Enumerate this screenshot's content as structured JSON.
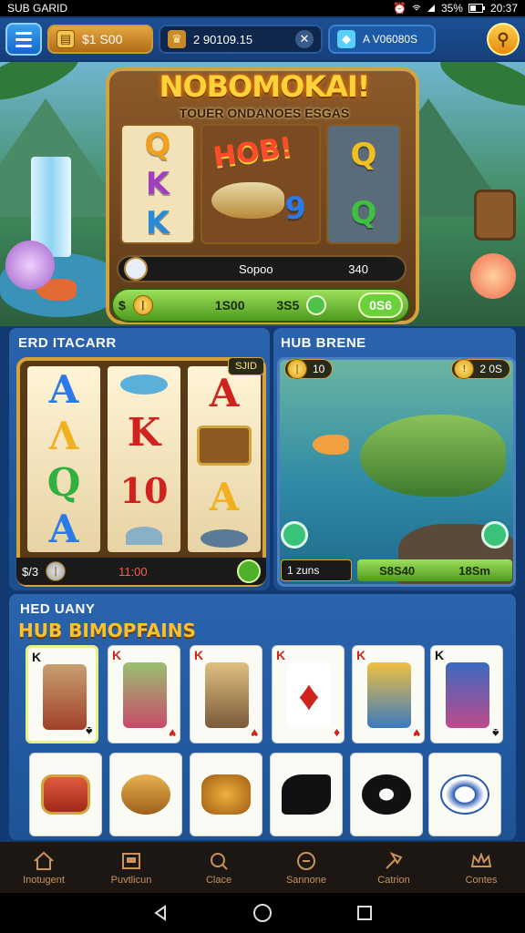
{
  "status_bar": {
    "left": "SUB GARID",
    "battery_text": "35%",
    "time": "20:37"
  },
  "topbar": {
    "coins": "$1 S00",
    "balance": "2 90109.15",
    "gems": "A V06080S"
  },
  "hero": {
    "title": "NOBOMOKAI!",
    "subtitle": "TOUER ONDANOES ESGAS",
    "big_label": "HOB!",
    "reel1": [
      "Q",
      "K",
      "K"
    ],
    "reel3": [
      "Q",
      "Q"
    ],
    "reel2_symbol": "9",
    "bar1_label": "Sopoo",
    "bar1_value": "340",
    "bar2_coin": "$",
    "bar2_value1": "1S00",
    "bar2_value2": "3S5",
    "bar2_last": "0S6"
  },
  "panel_left": {
    "title": "ERD ITACARR",
    "badge": "SJID",
    "reel1": [
      "A",
      "Λ",
      "Q",
      "A"
    ],
    "reel2": [
      "K",
      "10"
    ],
    "reel3": [
      "A",
      "A"
    ],
    "foot_left": "$/3",
    "foot_mid": "11:00"
  },
  "panel_right": {
    "title": "HUB BRENE",
    "chip_left": "10",
    "chip_right": "2 0S",
    "foot_label": "1 zuns",
    "foot_value1": "S8S40",
    "foot_value2": "18Sm"
  },
  "cards": {
    "header": "HED UANY",
    "subheader": "HUB BIMOPFAINS",
    "row1": [
      {
        "rank": "K",
        "suit": "♠",
        "color": "blk"
      },
      {
        "rank": "K",
        "suit": "♥",
        "color": "red"
      },
      {
        "rank": "K",
        "suit": "♥",
        "color": "red"
      },
      {
        "rank": "K",
        "suit": "♦",
        "color": "red"
      },
      {
        "rank": "K",
        "suit": "♥",
        "color": "red"
      },
      {
        "rank": "K",
        "suit": "♠",
        "color": "blk"
      }
    ]
  },
  "bottom_nav": {
    "items": [
      {
        "label": "Inotugent",
        "icon": "home-icon"
      },
      {
        "label": "Puvtlicun",
        "icon": "game-icon"
      },
      {
        "label": "Clace",
        "icon": "search-icon"
      },
      {
        "label": "Sannone",
        "icon": "clock-icon"
      },
      {
        "label": "Catrion",
        "icon": "hammer-icon"
      },
      {
        "label": "Contes",
        "icon": "crown-icon"
      }
    ]
  },
  "colors": {
    "gold": "#d4a43c",
    "panel_blue": "#2a64ad",
    "green": "#4f9a1e",
    "nav_text": "#c9935a"
  }
}
